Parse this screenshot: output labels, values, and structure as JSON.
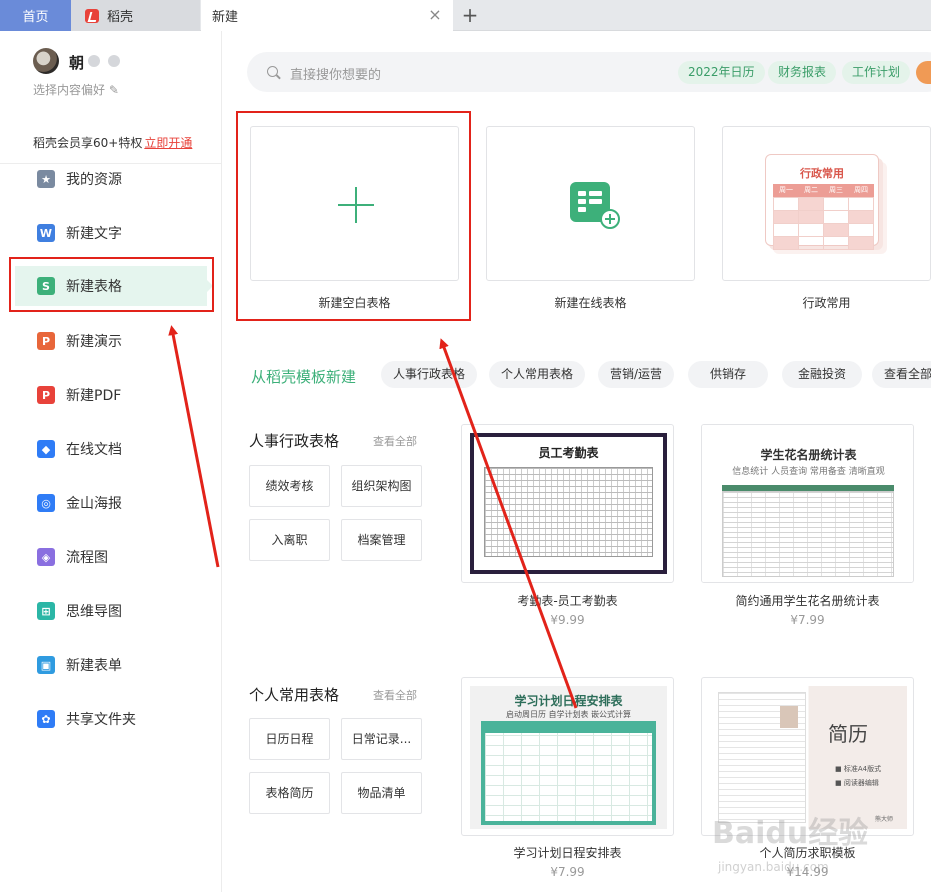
{
  "tabs": {
    "home": "首页",
    "daoke": "稻壳",
    "new": "新建",
    "close_icon": "×",
    "add_icon": "+"
  },
  "user": {
    "name": "朝",
    "preference": "选择内容偏好",
    "edit_icon": "✎",
    "vip_text": "稻壳会员享60+特权",
    "vip_link": "立即开通"
  },
  "sidebar": {
    "items": [
      {
        "label": "我的资源",
        "icon": "star-icon",
        "color": "#7a8aa0",
        "glyph": "★"
      },
      {
        "label": "新建文字",
        "icon": "writer-w-icon",
        "color": "#3f7fe0",
        "glyph": "W"
      },
      {
        "label": "新建表格",
        "icon": "spreadsheet-s-icon",
        "color": "#3db07a",
        "glyph": "S"
      },
      {
        "label": "新建演示",
        "icon": "presentation-p-icon",
        "color": "#e8663a",
        "glyph": "P"
      },
      {
        "label": "新建PDF",
        "icon": "pdf-icon",
        "color": "#e8423a",
        "glyph": "P"
      },
      {
        "label": "在线文档",
        "icon": "online-doc-icon",
        "color": "#2f7cf6",
        "glyph": "◆"
      },
      {
        "label": "金山海报",
        "icon": "poster-icon",
        "color": "#2f7cf6",
        "glyph": "◎"
      },
      {
        "label": "流程图",
        "icon": "flowchart-icon",
        "color": "#8a6fe0",
        "glyph": "◈"
      },
      {
        "label": "思维导图",
        "icon": "mindmap-icon",
        "color": "#2bb6a6",
        "glyph": "⊞"
      },
      {
        "label": "新建表单",
        "icon": "form-icon",
        "color": "#2f9be0",
        "glyph": "▣"
      },
      {
        "label": "共享文件夹",
        "icon": "shared-folder-icon",
        "color": "#2f7cf6",
        "glyph": "✿"
      }
    ],
    "active_index": 2
  },
  "search": {
    "placeholder": "直接搜你想要的",
    "chips": [
      "2022年日历",
      "财务报表",
      "工作计划"
    ]
  },
  "top_cards": [
    {
      "label": "新建空白表格"
    },
    {
      "label": "新建在线表格"
    },
    {
      "label": "行政常用",
      "preview_title": "行政常用",
      "days": [
        "周一",
        "周二",
        "周三",
        "周四"
      ]
    }
  ],
  "template_section": {
    "title": "从稻壳模板新建",
    "pills": [
      "人事行政表格",
      "个人常用表格",
      "营销/运营",
      "供销存",
      "金融投资",
      "查看全部"
    ]
  },
  "categories": [
    {
      "title": "人事行政表格",
      "view_all": "查看全部",
      "tags": [
        "绩效考核",
        "组织架构图",
        "入离职",
        "档案管理"
      ],
      "templates": [
        {
          "name": "考勤表-员工考勤表",
          "price": "¥9.99",
          "preview_title": "员工考勤表"
        },
        {
          "name": "简约通用学生花名册统计表",
          "price": "¥7.99",
          "preview_title": "学生花名册统计表",
          "preview_sub": "信息统计 人员查询 常用备查 清晰直观"
        }
      ]
    },
    {
      "title": "个人常用表格",
      "view_all": "查看全部",
      "tags": [
        "日历日程",
        "日常记录...",
        "表格简历",
        "物品清单"
      ],
      "templates": [
        {
          "name": "学习计划日程安排表",
          "price": "¥7.99",
          "preview_title": "学习计划日程安排表",
          "preview_sub": "启动周日历  自学计划表  嵌公式计算"
        },
        {
          "name": "个人简历求职模板",
          "price": "¥14.99",
          "preview_title": "简历",
          "preview_b1": "■ 标准A4版式",
          "preview_b2": "■ 阅读器编辑",
          "preview_foot": "熊大师"
        }
      ]
    }
  ],
  "watermark": {
    "text": "Baidu经验",
    "url": "jingyan.baidu.com"
  },
  "colors": {
    "accent_green": "#3db07a",
    "annotation_red": "#e2231a",
    "home_tab": "#6a8bd9"
  }
}
